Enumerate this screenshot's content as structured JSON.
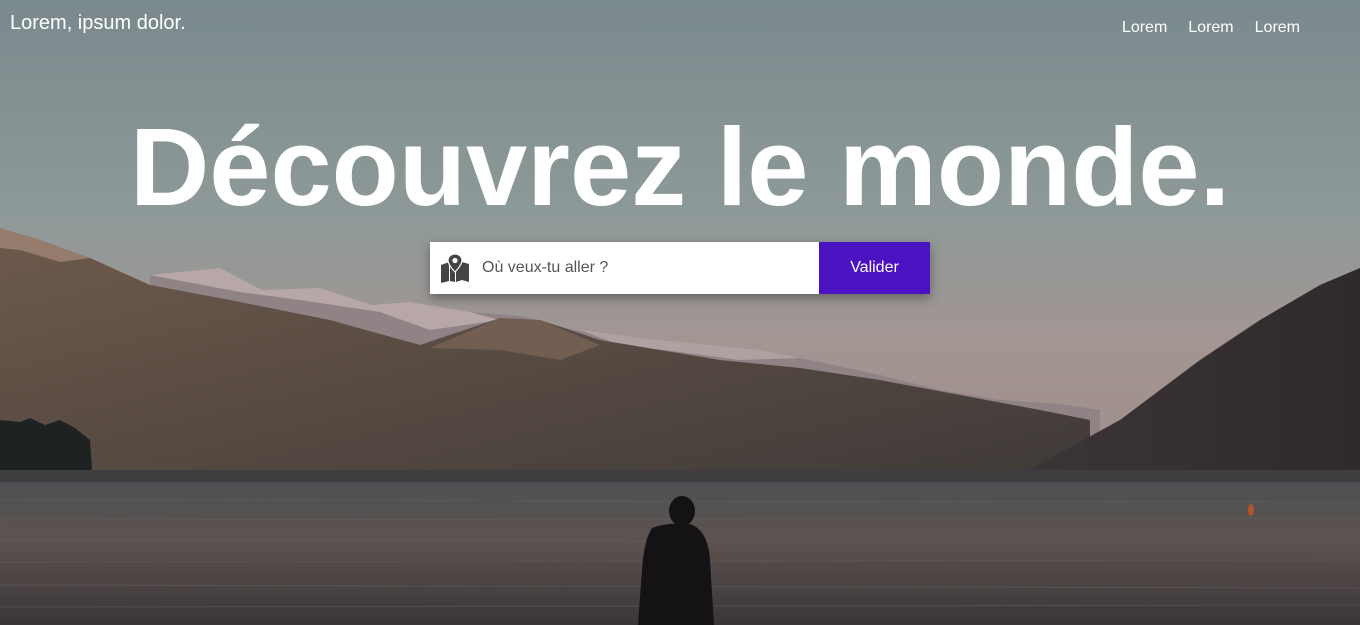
{
  "header": {
    "brand": "Lorem, ipsum dolor.",
    "nav": [
      "Lorem",
      "Lorem",
      "Lorem"
    ]
  },
  "hero": {
    "title": "Découvrez le monde."
  },
  "search": {
    "placeholder": "Où veux-tu aller ?",
    "value": "",
    "submit_label": "Valider",
    "icon": "map-marker-icon"
  },
  "colors": {
    "accent": "#4a12c0",
    "text": "#ffffff"
  }
}
